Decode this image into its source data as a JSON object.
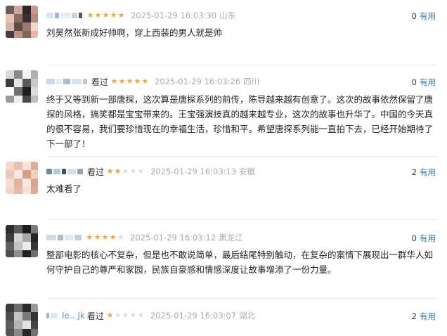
{
  "reviews": [
    {
      "user_text": "",
      "status": "",
      "rating": 5,
      "time": "2025-01-29 16:03:30",
      "location": "山东",
      "useful_count": "0",
      "useful_label": "有用",
      "content": "刘昊然张新成好帅啊，穿上西装的男人就是帅",
      "avatar_colors": [
        "#6a5d5a",
        "#cfa79a",
        "#2b2525",
        "#c7998c",
        "#e8c0b4",
        "#8a6b66",
        "#3a3030",
        "#b78a80",
        "#d6b3a8",
        "#5c4d4b",
        "#9d7a74",
        "#f0d8cf",
        "#4a3c3a",
        "#c29085",
        "#7f6660",
        "#e2b8ab"
      ]
    },
    {
      "user_text": "",
      "status": "看过",
      "rating": 5,
      "time": "2025-01-29 16:03:26",
      "location": "四川",
      "useful_count": "0",
      "useful_label": "有用",
      "content": "终于又等到新一部唐探，这次算是唐探系列的前传，陈导越来越有创意了。这次的故事依然保留了唐探的风格，搞笑都是宝宝带来的。王宝强演技真的越来越专业，这次的故事也升华了。中国的今天真的很不容易，我们要珍惜现在的幸福生活，珍惜和平。希望唐探系列能一直拍下去，已经开始期待了下一部了！",
      "avatar_colors": [
        "#d9d9d9",
        "#8a8a8a",
        "#f2f2f2",
        "#b0b0b0",
        "#3d3d3d",
        "#e6e6e6",
        "#5a5a5a",
        "#c8c8c8",
        "#ffffff",
        "#707070",
        "#1f1f1f",
        "#dcdcdc",
        "#9a9a9a",
        "#eeeeee",
        "#4a4a4a",
        "#bdbdbd"
      ]
    },
    {
      "user_text": "",
      "status": "看过",
      "rating": 2,
      "time": "2025-01-29 16:03:13",
      "location": "安徽",
      "useful_count": "2",
      "useful_label": "有用",
      "content": "太难看了",
      "avatar_colors": [
        "#f3d9cd",
        "#e9c1b0",
        "#f7e3d8",
        "#dfae99",
        "#eccab9",
        "#f8e8df",
        "#d89f87",
        "#efd2c3",
        "#f4ddd1",
        "#e2b5a1",
        "#fae9e0",
        "#dba48c",
        "#f0d4c6",
        "#e6bca9",
        "#f6e1d6",
        "#ddaa94"
      ]
    },
    {
      "user_text": "",
      "status": "",
      "rating": 4,
      "time": "2025-01-29 16:03:12",
      "location": "黑龙江",
      "useful_count": "0",
      "useful_label": "有用",
      "content": "整部电影的核心不复杂，但是也不敢说简单，最后结尾特别触动，在复杂的案情下展现出一群华人如何守护自己的尊严和家园，民族自豪感和情感深度让故事增添了一份力量。",
      "avatar_colors": [
        "#2c2c2c",
        "#5a5a5a",
        "#1b1b1b",
        "#7c7c7c",
        "#3f3f3f",
        "#d5d5d5",
        "#a8a8a8",
        "#262626",
        "#606060",
        "#c2c2c2",
        "#eaeaea",
        "#343434",
        "#4d4d4d",
        "#8f8f8f",
        "#1f1f1f",
        "#6e6e6e"
      ]
    },
    {
      "user_text": "Ie.. Jk",
      "status": "看过",
      "rating": 1,
      "time": "2025-01-29 16:03:07",
      "location": "湖北",
      "useful_count": "2",
      "useful_label": "有用",
      "content": "",
      "avatar_colors": [
        "#3a3a3a",
        "#6b6b6b",
        "#2a2a2a",
        "#9a9a9a",
        "#4d4d4d",
        "#c4c4c4",
        "#7a7a7a",
        "#333333",
        "#5e5e5e",
        "#b3b3b3",
        "#e0e0e0",
        "#444444",
        "#555555",
        "#888888",
        "#262626",
        "#707070"
      ]
    }
  ]
}
